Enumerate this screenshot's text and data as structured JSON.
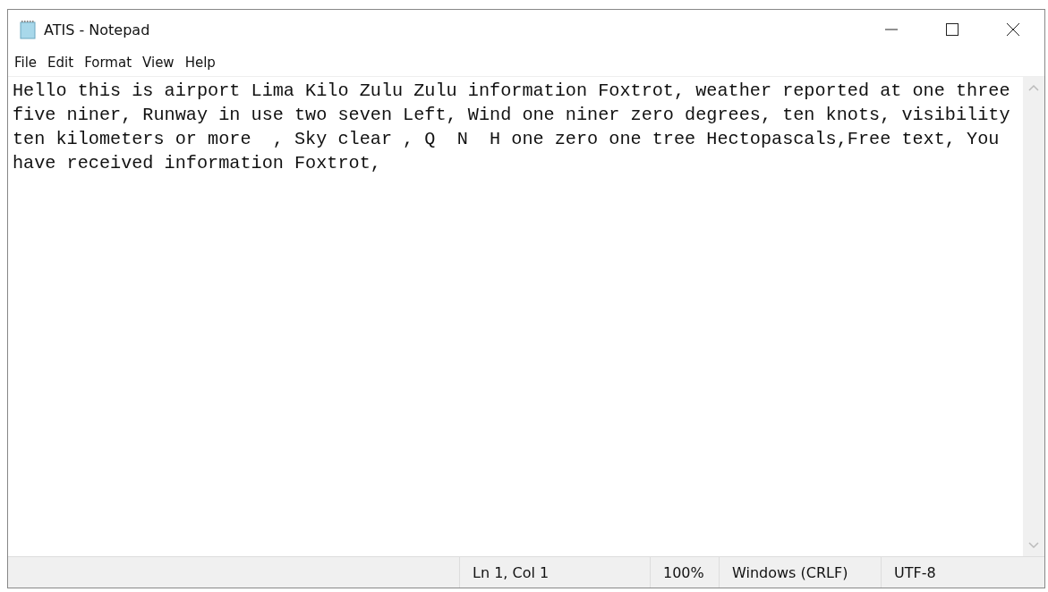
{
  "window": {
    "title": "ATIS - Notepad"
  },
  "menu": [
    "File",
    "Edit",
    "Format",
    "View",
    "Help"
  ],
  "editor": {
    "lines": [
      "Hello this is airport Lima Kilo Zulu Zulu information Foxtrot, weather reported at one three",
      "five niner, Runway in use two seven Left, Wind one niner zero degrees, ten knots, visibility",
      "ten kilometers or more  , Sky clear , Q  N  H one zero one tree Hectopascals,Free text, You",
      "have received information Foxtrot,"
    ]
  },
  "status_bar": [
    "Ln 1, Col 1",
    "100%",
    "Windows (CRLF)",
    "UTF-8"
  ]
}
